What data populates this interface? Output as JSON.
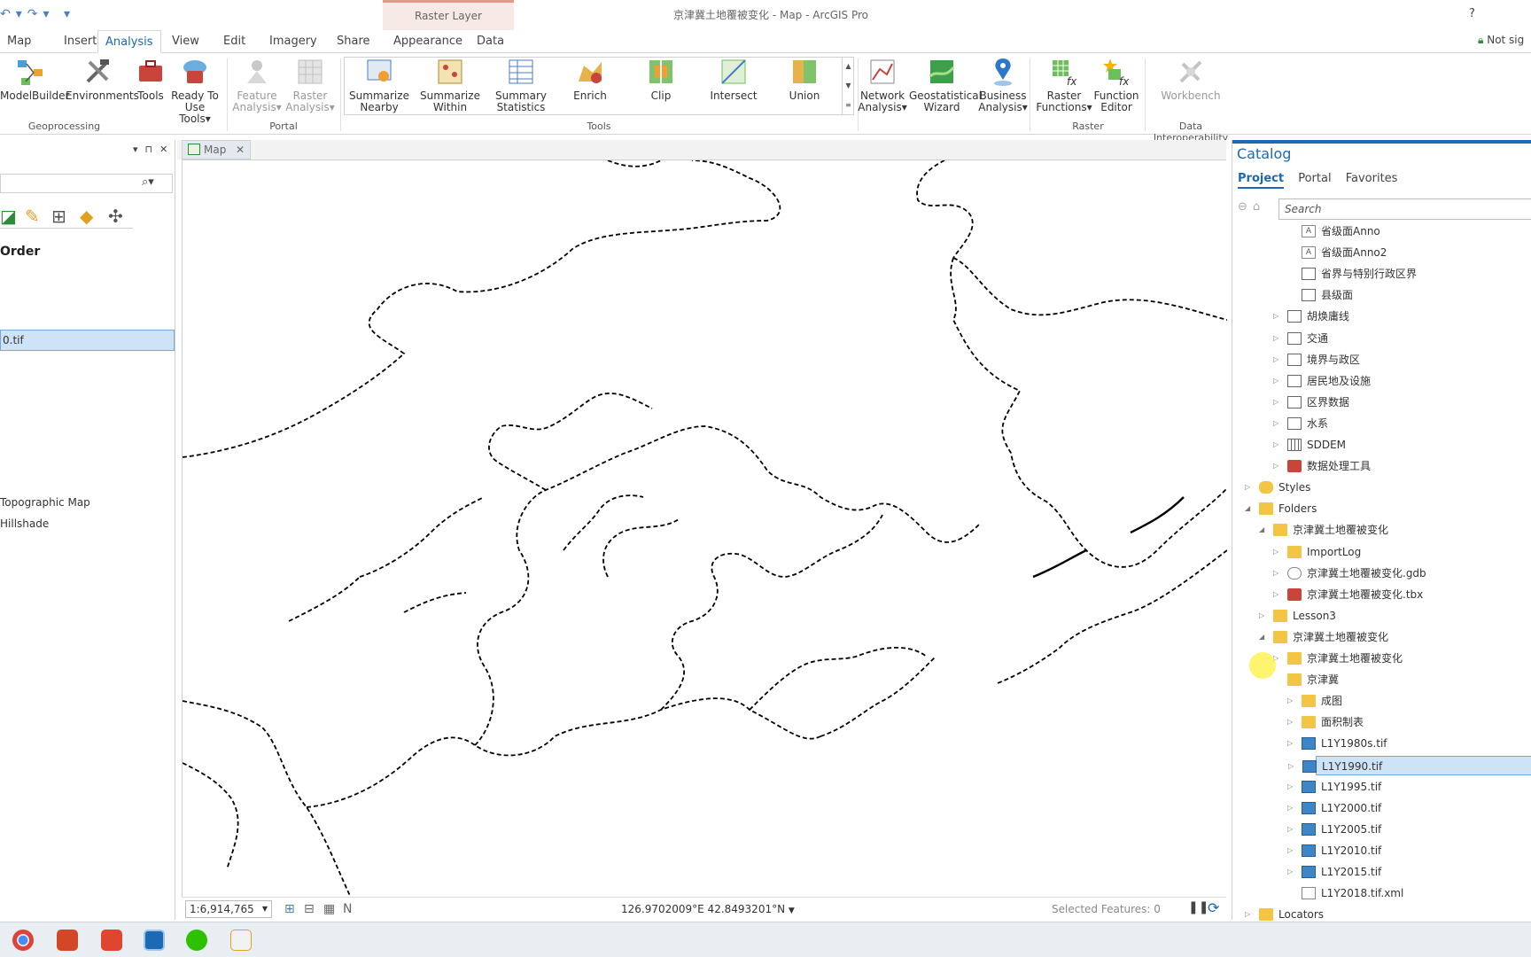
{
  "window": {
    "title": "京津冀土地覆被变化 - Map - ArcGIS Pro",
    "context_tab": "Raster Layer",
    "help": "?",
    "signin": "Not sig"
  },
  "ribbon_tabs": [
    "Map",
    "Insert",
    "Analysis",
    "View",
    "Edit",
    "Imagery",
    "Share",
    "Appearance",
    "Data"
  ],
  "active_tab": "Analysis",
  "ribbon": {
    "geoprocessing": {
      "group": "Geoprocessing",
      "modelbuilder": "ModelBuilder",
      "environments": "Environments",
      "tools": "Tools",
      "ready1": "Ready To",
      "ready2": "Use Tools"
    },
    "portal": {
      "group": "Portal",
      "feature1": "Feature",
      "feature2": "Analysis",
      "raster1": "Raster",
      "raster2": "Analysis"
    },
    "tools": {
      "group": "Tools",
      "items": [
        {
          "l1": "Summarize",
          "l2": "Nearby"
        },
        {
          "l1": "Summarize",
          "l2": "Within"
        },
        {
          "l1": "Summary",
          "l2": "Statistics"
        },
        {
          "l1": "Enrich",
          "l2": ""
        },
        {
          "l1": "Clip",
          "l2": ""
        },
        {
          "l1": "Intersect",
          "l2": ""
        },
        {
          "l1": "Union",
          "l2": ""
        }
      ]
    },
    "network1": "Network",
    "network2": "Analysis",
    "geostat1": "Geostatistical",
    "geostat2": "Wizard",
    "business1": "Business",
    "business2": "Analysis",
    "raster": {
      "group": "Raster",
      "rf1": "Raster",
      "rf2": "Functions",
      "fe1": "Function",
      "fe2": "Editor"
    },
    "interop": {
      "group": "Data Interoperability",
      "workbench": "Workbench"
    }
  },
  "left_panel": {
    "order_label": "Order",
    "selected_layer": "0.tif",
    "basemaps": [
      "Topographic Map",
      "Hillshade"
    ]
  },
  "map_tab": {
    "label": "Map"
  },
  "status": {
    "scale": "1:6,914,765",
    "coords": "126.9702009°E 42.8493201°N",
    "selected_features": "Selected Features: 0"
  },
  "catalog": {
    "title": "Catalog",
    "tabs": [
      "Project",
      "Portal",
      "Favorites"
    ],
    "search_placeholder": "Search",
    "rows": [
      {
        "label": "省级面Anno",
        "indent": 3,
        "icon": "ann",
        "arrow": ""
      },
      {
        "label": "省级面Anno2",
        "indent": 3,
        "icon": "ann",
        "arrow": ""
      },
      {
        "label": "省界与特别行政区界",
        "indent": 3,
        "icon": "layer",
        "arrow": ""
      },
      {
        "label": "县级面",
        "indent": 3,
        "icon": "layer",
        "arrow": ""
      },
      {
        "label": "胡焕庸线",
        "indent": 2,
        "icon": "layer",
        "arrow": "▷"
      },
      {
        "label": "交通",
        "indent": 2,
        "icon": "layer",
        "arrow": "▷"
      },
      {
        "label": "境界与政区",
        "indent": 2,
        "icon": "layer",
        "arrow": "▷"
      },
      {
        "label": "居民地及设施",
        "indent": 2,
        "icon": "layer",
        "arrow": "▷"
      },
      {
        "label": "区界数据",
        "indent": 2,
        "icon": "layer",
        "arrow": "▷"
      },
      {
        "label": "水系",
        "indent": 2,
        "icon": "layer",
        "arrow": "▷"
      },
      {
        "label": "SDDEM",
        "indent": 2,
        "icon": "grid",
        "arrow": "▷"
      },
      {
        "label": "数据处理工具",
        "indent": 2,
        "icon": "tbx",
        "arrow": "▷"
      },
      {
        "label": "Styles",
        "indent": 0,
        "icon": "style",
        "arrow": "▷"
      },
      {
        "label": "Folders",
        "indent": 0,
        "icon": "folder",
        "arrow": "◢"
      },
      {
        "label": "京津冀土地覆被变化",
        "indent": 1,
        "icon": "folder",
        "arrow": "◢"
      },
      {
        "label": "ImportLog",
        "indent": 2,
        "icon": "folder",
        "arrow": "▷"
      },
      {
        "label": "京津冀土地覆被变化.gdb",
        "indent": 2,
        "icon": "gdb",
        "arrow": "▷"
      },
      {
        "label": "京津冀土地覆被变化.tbx",
        "indent": 2,
        "icon": "tbx",
        "arrow": "▷"
      },
      {
        "label": "Lesson3",
        "indent": 1,
        "icon": "folder",
        "arrow": "▷"
      },
      {
        "label": "京津冀土地覆被变化",
        "indent": 1,
        "icon": "folder",
        "arrow": "◢"
      },
      {
        "label": "京津冀土地覆被变化",
        "indent": 2,
        "icon": "folder",
        "arrow": "▷"
      },
      {
        "label": "京津冀",
        "indent": 2,
        "icon": "folder",
        "arrow": ""
      },
      {
        "label": "成图",
        "indent": 3,
        "icon": "folder",
        "arrow": "▷"
      },
      {
        "label": "面积制表",
        "indent": 3,
        "icon": "folder",
        "arrow": "▷"
      },
      {
        "label": "L1Y1980s.tif",
        "indent": 3,
        "icon": "raster",
        "arrow": "▷"
      },
      {
        "label": "L1Y1990.tif",
        "indent": 3,
        "icon": "raster",
        "arrow": "▷",
        "selected": true
      },
      {
        "label": "L1Y1995.tif",
        "indent": 3,
        "icon": "raster",
        "arrow": "▷"
      },
      {
        "label": "L1Y2000.tif",
        "indent": 3,
        "icon": "raster",
        "arrow": "▷"
      },
      {
        "label": "L1Y2005.tif",
        "indent": 3,
        "icon": "raster",
        "arrow": "▷"
      },
      {
        "label": "L1Y2010.tif",
        "indent": 3,
        "icon": "raster",
        "arrow": "▷"
      },
      {
        "label": "L1Y2015.tif",
        "indent": 3,
        "icon": "raster",
        "arrow": "▷"
      },
      {
        "label": "L1Y2018.tif.xml",
        "indent": 3,
        "icon": "xml",
        "arrow": ""
      },
      {
        "label": "Locators",
        "indent": 0,
        "icon": "folder",
        "arrow": "▷"
      }
    ]
  },
  "colors": {
    "accent": "#1b6ab3",
    "selection": "#cfe3f6",
    "context_tab": "#f7e9e6"
  },
  "taskbar_icons": [
    "chrome-icon",
    "powerpoint-icon",
    "xmind-icon",
    "arcgis-icon",
    "wechat-icon",
    "photo-icon"
  ]
}
